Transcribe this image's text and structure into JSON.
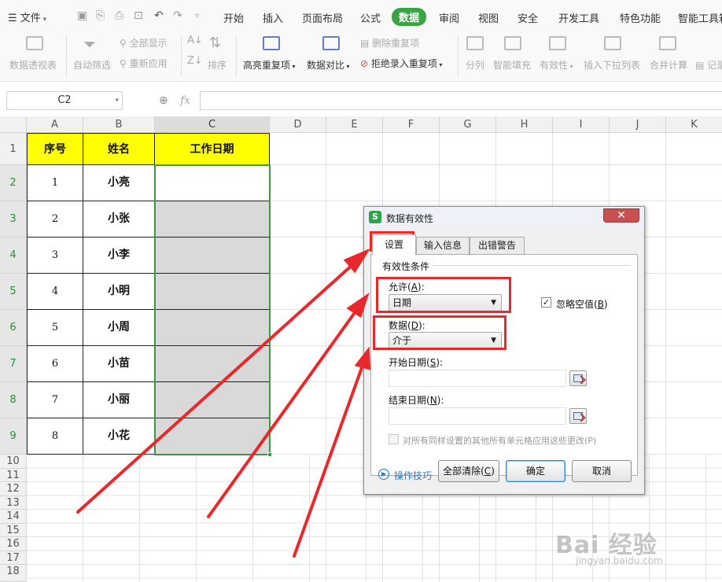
{
  "menubar": {
    "file_label": "文件",
    "tabs": [
      "开始",
      "插入",
      "页面布局",
      "公式",
      "数据",
      "审阅",
      "视图",
      "安全",
      "开发工具",
      "特色功能",
      "智能工具箱"
    ],
    "active_tab": "数据"
  },
  "ribbon": {
    "pivot": "数据透视表",
    "autofilter": "自动筛选",
    "show_all": "全部显示",
    "reapply": "重新应用",
    "sort": "排序",
    "highlight_dup": "高亮重复项",
    "compare": "数据对比",
    "remove_dup": "删除重复项",
    "reject_dup": "拒绝录入重复项",
    "split": "分列",
    "smart_fill": "智能填充",
    "validity": "有效性",
    "insert_dropdown": "插入下拉列表",
    "consolidate": "合并计算",
    "record": "记录"
  },
  "formulabar": {
    "namebox": "C2",
    "fx": "fx",
    "value": ""
  },
  "sheet": {
    "columns": [
      "A",
      "B",
      "C",
      "D",
      "E",
      "F",
      "G",
      "H",
      "I",
      "J",
      "K"
    ],
    "rows": [
      "1",
      "2",
      "3",
      "4",
      "5",
      "6",
      "7",
      "8",
      "9",
      "10",
      "11",
      "12",
      "13",
      "14",
      "15",
      "16",
      "17",
      "18"
    ],
    "table_header": [
      "序号",
      "姓名",
      "工作日期"
    ],
    "table_rows": [
      [
        "1",
        "小亮"
      ],
      [
        "2",
        "小张"
      ],
      [
        "3",
        "小李"
      ],
      [
        "4",
        "小明"
      ],
      [
        "5",
        "小周"
      ],
      [
        "6",
        "小苗"
      ],
      [
        "7",
        "小丽"
      ],
      [
        "8",
        "小花"
      ]
    ],
    "header_fill": "#ffff00",
    "selection_color": "#3b9943"
  },
  "dialog": {
    "title": "数据有效性",
    "tabs": [
      "设置",
      "输入信息",
      "出错警告"
    ],
    "group_label": "有效性条件",
    "allow_label": "允许(",
    "allow_key": "A",
    "allow_value": "日期",
    "ignore_blank_label": "忽略空值(",
    "ignore_blank_key": "B",
    "ignore_blank_checked": "✓",
    "data_label": "数据(",
    "data_key": "D",
    "data_value": "介于",
    "start_label": "开始日期(",
    "start_key": "S",
    "end_label": "结束日期(",
    "end_key": "N",
    "apply_all_label": "对所有同样设置的其他所有单元格应用这些更改(P)",
    "tips": "操作技巧",
    "clear_all": "全部清除(",
    "clear_all_key": "C",
    "ok": "确定",
    "cancel": "取消",
    "close_glyph": "✕"
  },
  "watermark": {
    "logo": "Bai 经验",
    "url": "jingyan.baidu.com"
  },
  "annotation_color": "#e8282a"
}
